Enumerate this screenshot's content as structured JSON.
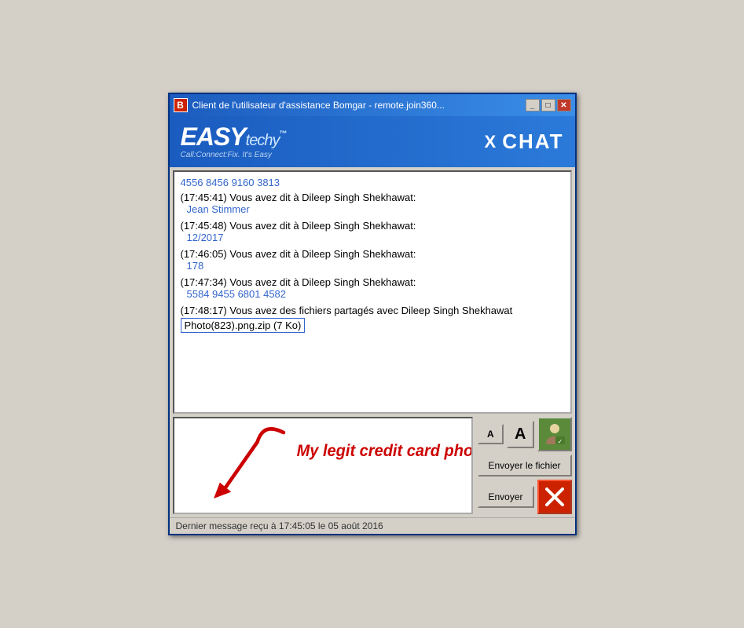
{
  "window": {
    "title": "Client de l'utilisateur d'assistance Bomgar - remote.join360...",
    "icon_label": "B",
    "btn_minimize": "_",
    "btn_maximize": "□",
    "btn_close": "✕"
  },
  "branding": {
    "logo_easy": "EASY",
    "logo_techy": "techy",
    "logo_tm": "™",
    "tagline": "Call:Connect:Fix. It's Easy",
    "x_label": "X",
    "chat_label": "CHAT"
  },
  "chat": {
    "messages": [
      {
        "id": "msg0",
        "prefix": "",
        "value": "4556 8456 9160 3813"
      },
      {
        "id": "msg1",
        "prefix": "(17:45:41) Vous avez dit à Dileep Singh Shekhawat:",
        "value": "Jean Stimmer"
      },
      {
        "id": "msg2",
        "prefix": "(17:45:48) Vous avez dit à Dileep Singh Shekhawat:",
        "value": "12/2017"
      },
      {
        "id": "msg3",
        "prefix": "(17:46:05) Vous avez dit à Dileep Singh Shekhawat:",
        "value": "178"
      },
      {
        "id": "msg4",
        "prefix": "(17:47:34) Vous avez dit à Dileep Singh Shekhawat:",
        "value": "5584 9455 6801 4582"
      },
      {
        "id": "msg5",
        "prefix": "(17:48:17) Vous avez des fichiers partagés avec Dileep Singh Shekhawat",
        "value": "",
        "file_link": "Photo(823).png.zip (7 Ko)"
      }
    ]
  },
  "input": {
    "placeholder": "",
    "cursor": "|"
  },
  "buttons": {
    "font_small": "A",
    "font_large": "A",
    "send_file": "Envoyer le fichier",
    "send": "Envoyer"
  },
  "status_bar": {
    "text": "Dernier message reçu à 17:45:05 le 05 août 2016"
  },
  "colors": {
    "accent_blue": "#3366cc",
    "bg_blue": "#1a5bbf",
    "red": "#cc2200",
    "green": "#5a8a3a"
  }
}
